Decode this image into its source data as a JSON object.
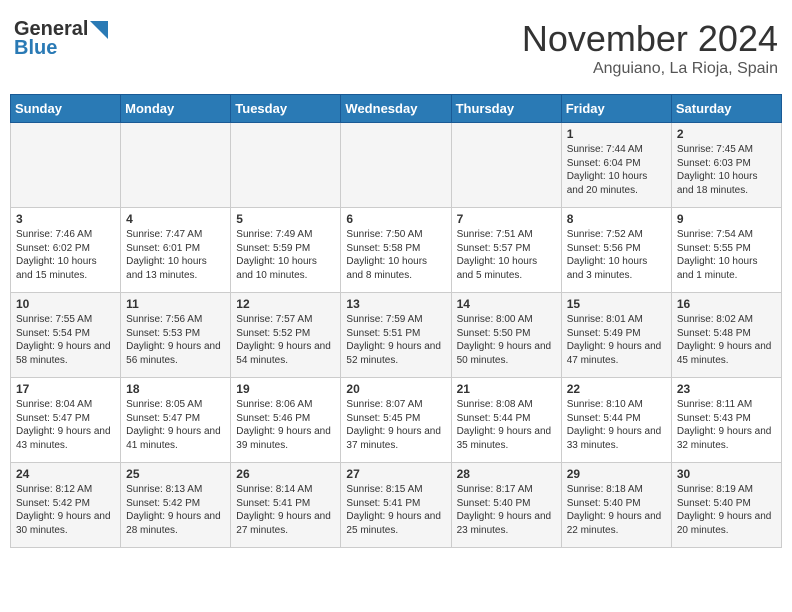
{
  "logo": {
    "general": "General",
    "blue": "Blue"
  },
  "header": {
    "month": "November 2024",
    "location": "Anguiano, La Rioja, Spain"
  },
  "weekdays": [
    "Sunday",
    "Monday",
    "Tuesday",
    "Wednesday",
    "Thursday",
    "Friday",
    "Saturday"
  ],
  "weeks": [
    [
      {
        "day": "",
        "content": ""
      },
      {
        "day": "",
        "content": ""
      },
      {
        "day": "",
        "content": ""
      },
      {
        "day": "",
        "content": ""
      },
      {
        "day": "",
        "content": ""
      },
      {
        "day": "1",
        "content": "Sunrise: 7:44 AM\nSunset: 6:04 PM\nDaylight: 10 hours and 20 minutes."
      },
      {
        "day": "2",
        "content": "Sunrise: 7:45 AM\nSunset: 6:03 PM\nDaylight: 10 hours and 18 minutes."
      }
    ],
    [
      {
        "day": "3",
        "content": "Sunrise: 7:46 AM\nSunset: 6:02 PM\nDaylight: 10 hours and 15 minutes."
      },
      {
        "day": "4",
        "content": "Sunrise: 7:47 AM\nSunset: 6:01 PM\nDaylight: 10 hours and 13 minutes."
      },
      {
        "day": "5",
        "content": "Sunrise: 7:49 AM\nSunset: 5:59 PM\nDaylight: 10 hours and 10 minutes."
      },
      {
        "day": "6",
        "content": "Sunrise: 7:50 AM\nSunset: 5:58 PM\nDaylight: 10 hours and 8 minutes."
      },
      {
        "day": "7",
        "content": "Sunrise: 7:51 AM\nSunset: 5:57 PM\nDaylight: 10 hours and 5 minutes."
      },
      {
        "day": "8",
        "content": "Sunrise: 7:52 AM\nSunset: 5:56 PM\nDaylight: 10 hours and 3 minutes."
      },
      {
        "day": "9",
        "content": "Sunrise: 7:54 AM\nSunset: 5:55 PM\nDaylight: 10 hours and 1 minute."
      }
    ],
    [
      {
        "day": "10",
        "content": "Sunrise: 7:55 AM\nSunset: 5:54 PM\nDaylight: 9 hours and 58 minutes."
      },
      {
        "day": "11",
        "content": "Sunrise: 7:56 AM\nSunset: 5:53 PM\nDaylight: 9 hours and 56 minutes."
      },
      {
        "day": "12",
        "content": "Sunrise: 7:57 AM\nSunset: 5:52 PM\nDaylight: 9 hours and 54 minutes."
      },
      {
        "day": "13",
        "content": "Sunrise: 7:59 AM\nSunset: 5:51 PM\nDaylight: 9 hours and 52 minutes."
      },
      {
        "day": "14",
        "content": "Sunrise: 8:00 AM\nSunset: 5:50 PM\nDaylight: 9 hours and 50 minutes."
      },
      {
        "day": "15",
        "content": "Sunrise: 8:01 AM\nSunset: 5:49 PM\nDaylight: 9 hours and 47 minutes."
      },
      {
        "day": "16",
        "content": "Sunrise: 8:02 AM\nSunset: 5:48 PM\nDaylight: 9 hours and 45 minutes."
      }
    ],
    [
      {
        "day": "17",
        "content": "Sunrise: 8:04 AM\nSunset: 5:47 PM\nDaylight: 9 hours and 43 minutes."
      },
      {
        "day": "18",
        "content": "Sunrise: 8:05 AM\nSunset: 5:47 PM\nDaylight: 9 hours and 41 minutes."
      },
      {
        "day": "19",
        "content": "Sunrise: 8:06 AM\nSunset: 5:46 PM\nDaylight: 9 hours and 39 minutes."
      },
      {
        "day": "20",
        "content": "Sunrise: 8:07 AM\nSunset: 5:45 PM\nDaylight: 9 hours and 37 minutes."
      },
      {
        "day": "21",
        "content": "Sunrise: 8:08 AM\nSunset: 5:44 PM\nDaylight: 9 hours and 35 minutes."
      },
      {
        "day": "22",
        "content": "Sunrise: 8:10 AM\nSunset: 5:44 PM\nDaylight: 9 hours and 33 minutes."
      },
      {
        "day": "23",
        "content": "Sunrise: 8:11 AM\nSunset: 5:43 PM\nDaylight: 9 hours and 32 minutes."
      }
    ],
    [
      {
        "day": "24",
        "content": "Sunrise: 8:12 AM\nSunset: 5:42 PM\nDaylight: 9 hours and 30 minutes."
      },
      {
        "day": "25",
        "content": "Sunrise: 8:13 AM\nSunset: 5:42 PM\nDaylight: 9 hours and 28 minutes."
      },
      {
        "day": "26",
        "content": "Sunrise: 8:14 AM\nSunset: 5:41 PM\nDaylight: 9 hours and 27 minutes."
      },
      {
        "day": "27",
        "content": "Sunrise: 8:15 AM\nSunset: 5:41 PM\nDaylight: 9 hours and 25 minutes."
      },
      {
        "day": "28",
        "content": "Sunrise: 8:17 AM\nSunset: 5:40 PM\nDaylight: 9 hours and 23 minutes."
      },
      {
        "day": "29",
        "content": "Sunrise: 8:18 AM\nSunset: 5:40 PM\nDaylight: 9 hours and 22 minutes."
      },
      {
        "day": "30",
        "content": "Sunrise: 8:19 AM\nSunset: 5:40 PM\nDaylight: 9 hours and 20 minutes."
      }
    ]
  ]
}
